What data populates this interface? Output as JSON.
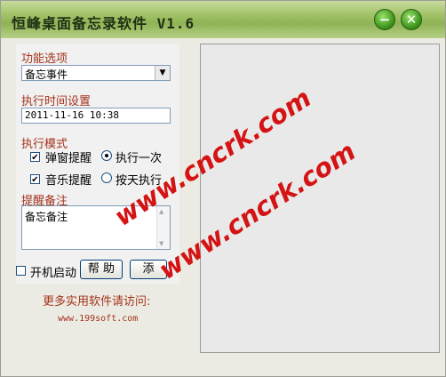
{
  "window": {
    "title": "恒峰桌面备忘录软件 V1.6"
  },
  "titlebar": {
    "minimize_glyph": "−",
    "close_glyph": "✕"
  },
  "function": {
    "label": "功能选项",
    "selected": "备忘事件"
  },
  "time": {
    "label": "执行时间设置",
    "value": "2011-11-16 10:38"
  },
  "mode": {
    "label": "执行模式",
    "popup_check": {
      "label": "弹窗提醒",
      "checked": true
    },
    "music_check": {
      "label": "音乐提醒",
      "checked": true
    },
    "once_radio": {
      "label": "执行一次",
      "selected": true
    },
    "daily_radio": {
      "label": "按天执行",
      "selected": false
    }
  },
  "note": {
    "label": "提醒备注",
    "value": "备忘备注"
  },
  "startup": {
    "label": "开机启动",
    "checked": false
  },
  "buttons": {
    "help": "帮 助",
    "add": "添"
  },
  "footer": {
    "visit_text": "更多实用软件请访问:",
    "url": "www.199soft.com"
  },
  "watermark": {
    "text": "www.cncrk.com"
  },
  "colors": {
    "titlebar": "#9fc064",
    "label": "#a3331c",
    "watermark": "#d41414"
  }
}
